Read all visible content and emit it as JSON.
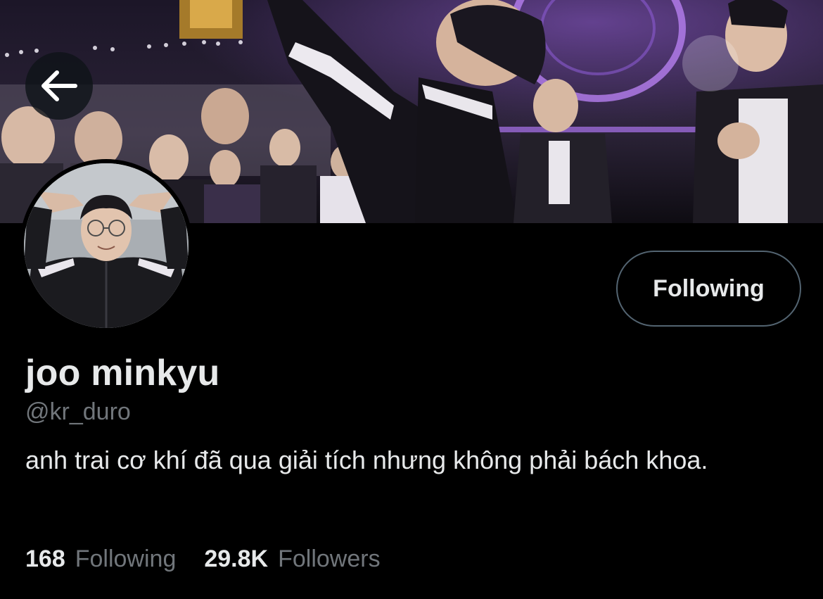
{
  "header": {
    "back_icon": "arrow-left-icon",
    "banner_description_icon": "banner-photo"
  },
  "profile": {
    "display_name": "joo minkyu",
    "handle": "@kr_duro",
    "bio": "anh trai cơ khí đã qua giải tích nhưng không phải bách khoa.",
    "follow_button_label": "Following"
  },
  "stats": {
    "following_count": "168",
    "following_label": "Following",
    "followers_count": "29.8K",
    "followers_label": "Followers"
  },
  "colors": {
    "background": "#000000",
    "primary_text": "#e7e9ea",
    "secondary_text": "#71767b",
    "button_border": "#536471"
  }
}
